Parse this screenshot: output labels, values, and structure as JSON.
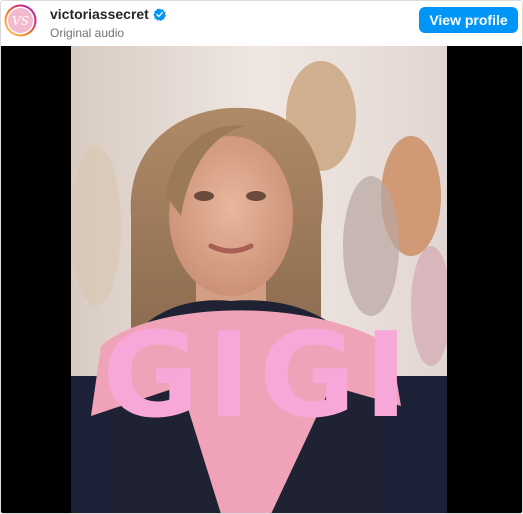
{
  "header": {
    "username": "victoriassecret",
    "verified_icon": "verified-badge-icon",
    "subtitle": "Original audio",
    "view_profile_label": "View profile",
    "avatar_icon": "vs-logo-icon"
  },
  "video": {
    "overlay_text": "GIGI",
    "overlay_color": "#f7a8d8"
  },
  "colors": {
    "accent": "#0095f6",
    "video_background": "#000000"
  }
}
